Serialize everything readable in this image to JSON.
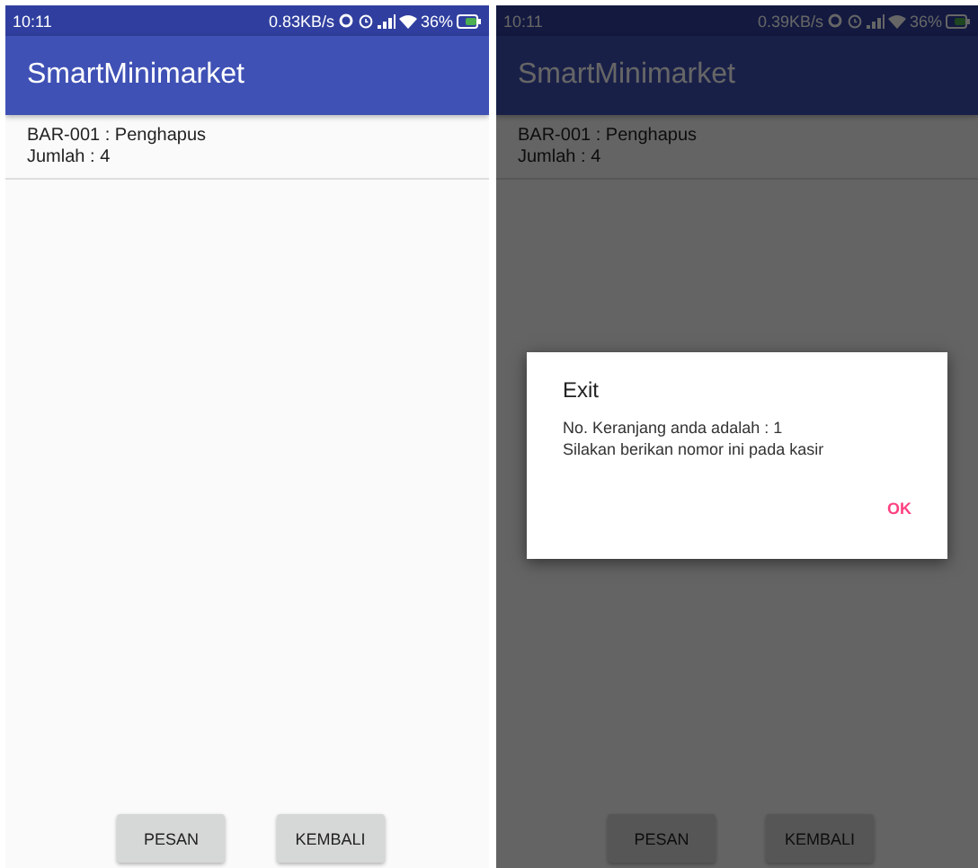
{
  "screens": [
    {
      "status_bar": {
        "time": "10:11",
        "speed": "0.83KB/s",
        "battery": "36%"
      },
      "app_bar": {
        "title": "SmartMinimarket"
      },
      "items": [
        {
          "code": "BAR-001 : Penghapus",
          "qty": "Jumlah : 4"
        }
      ],
      "buttons": [
        "PESAN",
        "KEMBALI"
      ]
    },
    {
      "status_bar": {
        "time": "10:11",
        "speed": "0.39KB/s",
        "battery": "36%"
      },
      "app_bar": {
        "title": "SmartMinimarket"
      },
      "items": [
        {
          "code": "BAR-001 : Penghapus",
          "qty": "Jumlah : 4"
        }
      ],
      "buttons": [
        "PESAN",
        "KEMBALI"
      ],
      "dialog": {
        "title": "Exit",
        "lines": [
          "No. Keranjang anda adalah : 1",
          "Silakan berikan nomor ini pada kasir"
        ],
        "button": "OK"
      }
    }
  ]
}
